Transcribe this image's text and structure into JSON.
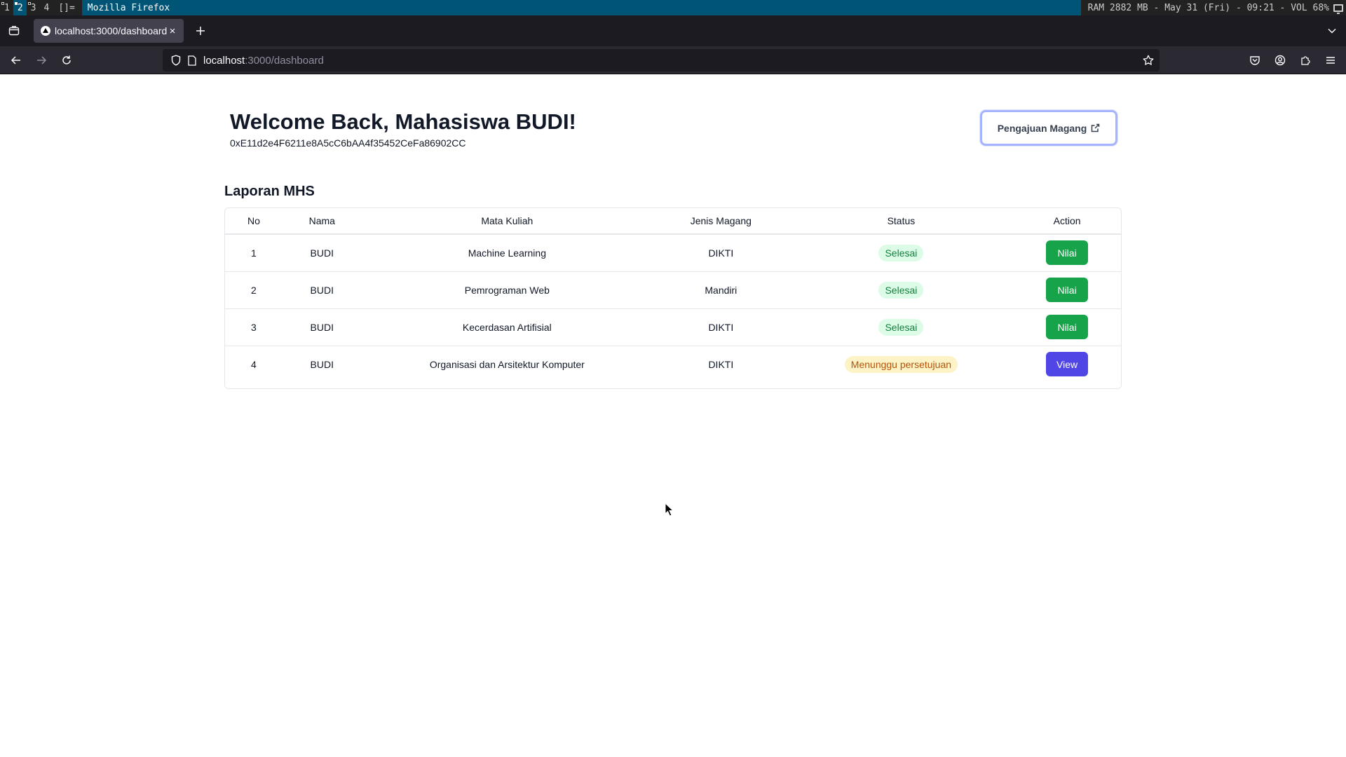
{
  "wm": {
    "workspaces": [
      "1",
      "2",
      "3",
      "4"
    ],
    "active_workspace": "2",
    "layout": "[]=",
    "window_title": "Mozilla Firefox",
    "status": "RAM 2882 MB - May 31 (Fri) - 09:21 - VOL 68%"
  },
  "browser": {
    "tab_title": "localhost:3000/dashboard",
    "url_host": "localhost",
    "url_path": ":3000/dashboard"
  },
  "page": {
    "welcome": "Welcome Back, Mahasiswa BUDI!",
    "wallet_address": "0xE11d2e4F6211e8A5cC6bAA4f35452CeFa86902CC",
    "pengajuan_button": "Pengajuan Magang",
    "section_title": "Laporan MHS",
    "table": {
      "headers": [
        "No",
        "Nama",
        "Mata Kuliah",
        "Jenis Magang",
        "Status",
        "Action"
      ],
      "rows": [
        {
          "no": "1",
          "nama": "BUDI",
          "mata_kuliah": "Machine Learning",
          "jenis_magang": "DIKTI",
          "status": "Selesai",
          "action": "Nilai"
        },
        {
          "no": "2",
          "nama": "BUDI",
          "mata_kuliah": "Pemrograman Web",
          "jenis_magang": "Mandiri",
          "status": "Selesai",
          "action": "Nilai"
        },
        {
          "no": "3",
          "nama": "BUDI",
          "mata_kuliah": "Kecerdasan Artifisial",
          "jenis_magang": "DIKTI",
          "status": "Selesai",
          "action": "Nilai"
        },
        {
          "no": "4",
          "nama": "BUDI",
          "mata_kuliah": "Organisasi dan Arsitektur Komputer",
          "jenis_magang": "DIKTI",
          "status": "Menunggu persetujuan",
          "action": "View"
        }
      ]
    }
  },
  "colors": {
    "status_done_bg": "#dcfce7",
    "status_done_text": "#15803d",
    "status_wait_bg": "#fef3c7",
    "status_wait_text": "#b45309",
    "action_green": "#16a34a",
    "action_indigo": "#4f46e5",
    "wm_accent": "#005577"
  }
}
